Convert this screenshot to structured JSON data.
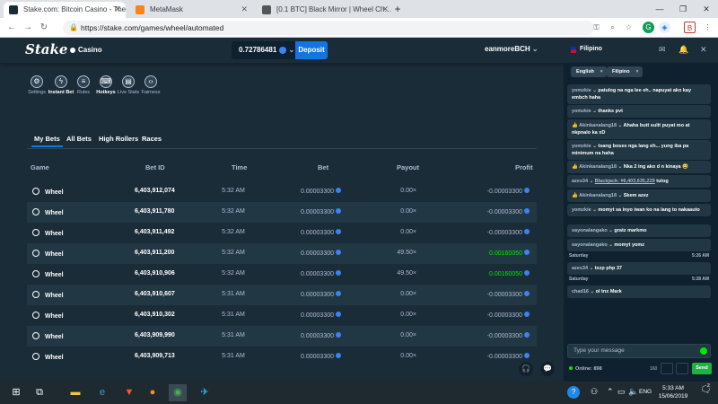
{
  "browser": {
    "tabs": [
      {
        "title": "Stake.com: Bitcoin Casino - The …",
        "active": true
      },
      {
        "title": "MetaMask",
        "active": false
      },
      {
        "title": "[0.1 BTC] Black Mirror | Wheel Ch…",
        "active": false
      }
    ],
    "url": "https://stake.com/games/wheel/automated",
    "new_tab_label": "+",
    "window_controls": {
      "minimize": "—",
      "maximize": "❐",
      "close": "✕"
    }
  },
  "header": {
    "logo": "Stake",
    "section": "Casino",
    "balance": "0.72786481",
    "deposit_label": "Deposit",
    "username": "eanmoreBCH"
  },
  "toolbar": [
    {
      "label": "Settings",
      "icon": "gear-icon"
    },
    {
      "label": "Instant Bet",
      "icon": "bolt-icon"
    },
    {
      "label": "Rules",
      "icon": "book-icon"
    },
    {
      "label": "Hotkeys",
      "icon": "keyboard-icon"
    },
    {
      "label": "Live Stats",
      "icon": "chart-icon"
    },
    {
      "label": "Fairness",
      "icon": "code-icon"
    }
  ],
  "bet_tabs": [
    {
      "label": "My Bets",
      "active": true
    },
    {
      "label": "All Bets",
      "active": false
    },
    {
      "label": "High Rollers",
      "active": false
    },
    {
      "label": "Races",
      "active": false
    }
  ],
  "table": {
    "columns": [
      "Game",
      "Bet ID",
      "Time",
      "Bet",
      "Payout",
      "Profit"
    ],
    "rows": [
      {
        "game": "Wheel",
        "id": "6,403,912,074",
        "time": "5:32 AM",
        "bet": "0.00003300",
        "payout": "0.00×",
        "profit": "-0.00003300",
        "win": false
      },
      {
        "game": "Wheel",
        "id": "6,403,911,780",
        "time": "5:32 AM",
        "bet": "0.00003300",
        "payout": "0.00×",
        "profit": "-0.00003300",
        "win": false
      },
      {
        "game": "Wheel",
        "id": "6,403,911,492",
        "time": "5:32 AM",
        "bet": "0.00003300",
        "payout": "0.00×",
        "profit": "-0.00003300",
        "win": false
      },
      {
        "game": "Wheel",
        "id": "6,403,911,200",
        "time": "5:32 AM",
        "bet": "0.00003300",
        "payout": "49.50×",
        "profit": "0.00160050",
        "win": true
      },
      {
        "game": "Wheel",
        "id": "6,403,910,906",
        "time": "5:32 AM",
        "bet": "0.00003300",
        "payout": "49.50×",
        "profit": "0.00160050",
        "win": true
      },
      {
        "game": "Wheel",
        "id": "6,403,910,607",
        "time": "5:31 AM",
        "bet": "0.00003300",
        "payout": "0.00×",
        "profit": "-0.00003300",
        "win": false
      },
      {
        "game": "Wheel",
        "id": "6,403,910,302",
        "time": "5:31 AM",
        "bet": "0.00003300",
        "payout": "0.00×",
        "profit": "-0.00003300",
        "win": false
      },
      {
        "game": "Wheel",
        "id": "6,403,909,990",
        "time": "5:31 AM",
        "bet": "0.00003300",
        "payout": "0.00×",
        "profit": "-0.00003300",
        "win": false
      },
      {
        "game": "Wheel",
        "id": "6,403,909,713",
        "time": "5:31 AM",
        "bet": "0.00003300",
        "payout": "0.00×",
        "profit": "-0.00003300",
        "win": false
      }
    ]
  },
  "chat": {
    "language": "Filipino",
    "lang_tabs": [
      "English",
      "Filipino"
    ],
    "messages": [
      {
        "user": "yomzkie",
        "text": "patulog na nga lee eh.. napuyat ako kay embch haha"
      },
      {
        "user": "yomzkie",
        "text": "thanks pvt"
      },
      {
        "user": "👍 Akinkanalang18",
        "text": "Ahaha butt sulit puyat mo at nkpnalo ka xD"
      },
      {
        "user": "yomzkie",
        "text": "tsang boses nga lang eh... yung iba pa minimum na haha"
      },
      {
        "user": "👍 Akinkanalang18",
        "text": "Nka 2 ing ako d n kinaya 😅"
      },
      {
        "user": "azes34",
        "link": "Blackjack: #6,403,635,229",
        "text": "tulog"
      },
      {
        "user": "👍 Akinkanalang18",
        "text": "Skem azez"
      },
      {
        "user": "yomzkie",
        "text": "momyt sa inyo iwan ko na lang to nakaauto"
      },
      {
        "user": "sayonalangako",
        "text": "gratz markmo"
      },
      {
        "user": "sayonalangako",
        "text": "momyt yomz"
      }
    ],
    "day1": {
      "label": "Saturday",
      "time": "5:26 AM"
    },
    "msg_after_day1": {
      "user": "azes34",
      "text": "txzp php 37"
    },
    "day2": {
      "label": "Saturday",
      "time": "5:28 AM"
    },
    "msg_after_day2": {
      "user": "chad16",
      "text": "ol tnx Mark"
    },
    "input_placeholder": "Type your message",
    "online": "Online: 898",
    "char_count": "160",
    "send_label": "Send"
  },
  "taskbar": {
    "lang": "ENG",
    "time": "5:33 AM",
    "date": "15/06/2019",
    "notification_count": "2"
  }
}
